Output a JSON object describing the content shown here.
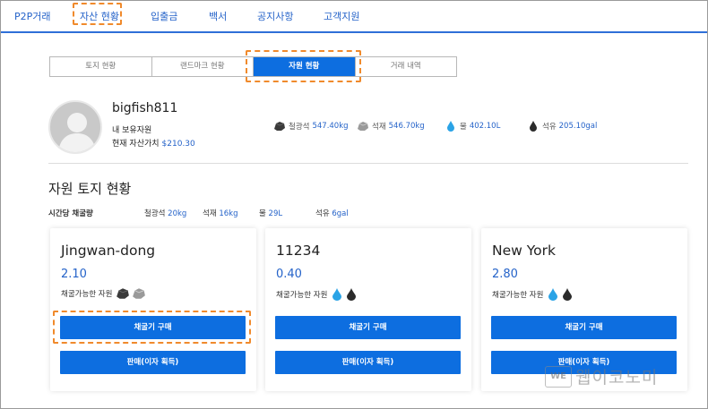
{
  "nav": {
    "items": [
      "P2P거래",
      "자산 현황",
      "입출금",
      "백서",
      "공지사항",
      "고객지원"
    ]
  },
  "subtabs": [
    "토지 현황",
    "랜드마크 현황",
    "자원 현황",
    "거래 내역"
  ],
  "profile": {
    "username": "bigfish811",
    "holdings_label": "내 보유자원",
    "asset_label": "현재 자산가치",
    "asset_value": "$210.30"
  },
  "resources": [
    {
      "icon": "iron-ore-icon",
      "label": "철광석",
      "value": "547.40kg"
    },
    {
      "icon": "stone-icon",
      "label": "석재",
      "value": "546.70kg"
    },
    {
      "icon": "water-drop-icon",
      "label": "물",
      "value": "402.10L"
    },
    {
      "icon": "oil-drop-icon",
      "label": "석유",
      "value": "205.10gal"
    }
  ],
  "section": {
    "title": "자원 토지 현황",
    "rate_label": "시간당 채굴량",
    "rates": [
      {
        "label": "철광석",
        "value": "20kg"
      },
      {
        "label": "석재",
        "value": "16kg"
      },
      {
        "label": "물",
        "value": "29L"
      },
      {
        "label": "석유",
        "value": "6gal"
      }
    ]
  },
  "cards": [
    {
      "name": "Jingwan-dong",
      "rate": "2.10",
      "res_label": "채굴가능한 자원",
      "buy": "채굴기 구매",
      "sell": "판매(이자 획득)"
    },
    {
      "name": "11234",
      "rate": "0.40",
      "res_label": "채굴가능한 자원",
      "buy": "채굴기 구매",
      "sell": "판매(이자 획득)"
    },
    {
      "name": "New York",
      "rate": "2.80",
      "res_label": "채굴가능한 자원",
      "buy": "채굴기 구매",
      "sell": "판매(이자 획득)"
    }
  ],
  "watermark": {
    "logo": "WE",
    "text": "웹이코노미"
  },
  "colors": {
    "accent": "#0d6ee0",
    "link": "#2563c9",
    "highlight": "#f08a2c"
  }
}
